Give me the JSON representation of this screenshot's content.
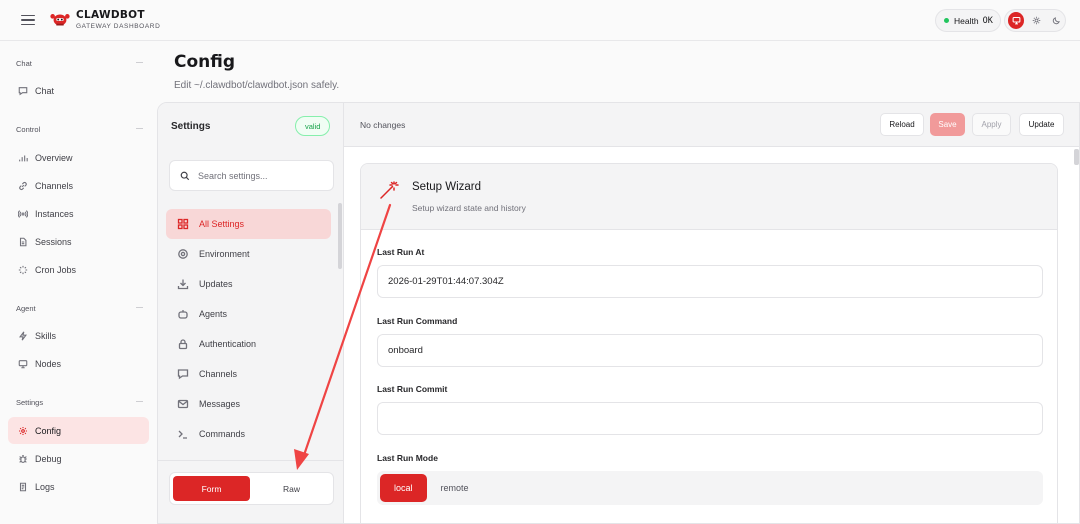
{
  "app": {
    "brand_title": "CLAWDBOT",
    "brand_subtitle": "GATEWAY DASHBOARD"
  },
  "header": {
    "health_label": "Health",
    "health_status": "OK"
  },
  "sidebar": {
    "groups": [
      {
        "label": "Chat",
        "items": [
          {
            "label": "Chat",
            "icon": "message-icon"
          }
        ]
      },
      {
        "label": "Control",
        "items": [
          {
            "label": "Overview",
            "icon": "bar-chart-icon"
          },
          {
            "label": "Channels",
            "icon": "link-icon"
          },
          {
            "label": "Instances",
            "icon": "radio-icon"
          },
          {
            "label": "Sessions",
            "icon": "file-icon"
          },
          {
            "label": "Cron Jobs",
            "icon": "loader-icon"
          }
        ]
      },
      {
        "label": "Agent",
        "items": [
          {
            "label": "Skills",
            "icon": "zap-icon"
          },
          {
            "label": "Nodes",
            "icon": "monitor-icon"
          }
        ]
      },
      {
        "label": "Settings",
        "items": [
          {
            "label": "Config",
            "icon": "gear-icon",
            "active": true
          },
          {
            "label": "Debug",
            "icon": "bug-icon"
          },
          {
            "label": "Logs",
            "icon": "scroll-icon"
          }
        ]
      }
    ]
  },
  "page": {
    "title": "Config",
    "subtitle": "Edit ~/.clawdbot/clawdbot.json safely."
  },
  "settings": {
    "title": "Settings",
    "status": "valid",
    "search_placeholder": "Search settings...",
    "items": [
      {
        "label": "All Settings",
        "icon": "grid-icon",
        "active": true
      },
      {
        "label": "Environment",
        "icon": "gear-icon"
      },
      {
        "label": "Updates",
        "icon": "download-icon"
      },
      {
        "label": "Agents",
        "icon": "bot-icon"
      },
      {
        "label": "Authentication",
        "icon": "lock-icon"
      },
      {
        "label": "Channels",
        "icon": "message-icon"
      },
      {
        "label": "Messages",
        "icon": "mail-icon"
      },
      {
        "label": "Commands",
        "icon": "terminal-icon"
      }
    ],
    "mode_form": "Form",
    "mode_raw": "Raw"
  },
  "toolbar": {
    "status": "No changes",
    "reload": "Reload",
    "save": "Save",
    "apply": "Apply",
    "update": "Update"
  },
  "wizard": {
    "title": "Setup Wizard",
    "subtitle": "Setup wizard state and history",
    "fields": [
      {
        "label": "Last Run At",
        "value": "2026-01-29T01:44:07.304Z"
      },
      {
        "label": "Last Run Command",
        "value": "onboard"
      },
      {
        "label": "Last Run Commit",
        "value": ""
      }
    ],
    "mode_label": "Last Run Mode",
    "mode_options": [
      "local",
      "remote"
    ],
    "mode_selected": "local"
  },
  "colors": {
    "accent": "#dc2626",
    "valid": "#16a34a"
  }
}
